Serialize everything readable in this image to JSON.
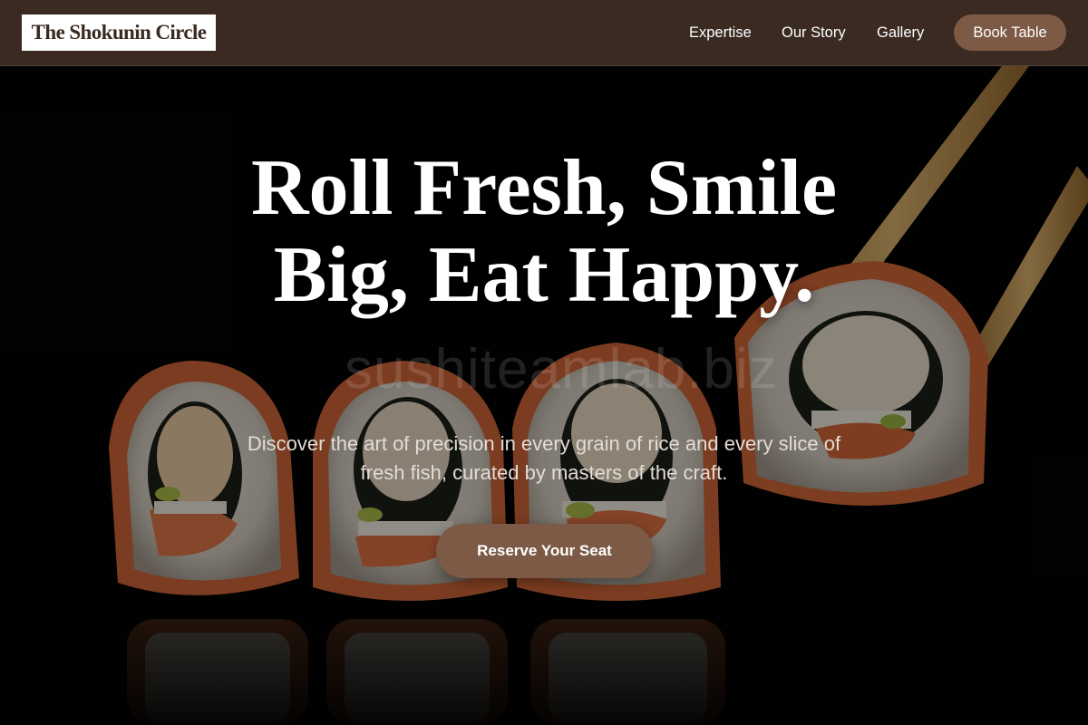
{
  "header": {
    "logo_text": "The Shokunin Circle",
    "nav_links": [
      "Expertise",
      "Our Story",
      "Gallery"
    ],
    "cta_label": "Book Table"
  },
  "hero": {
    "headline": "Roll Fresh, Smile Big, Eat Happy.",
    "subtext": "Discover the art of precision in every grain of rice and every slice of fresh fish, curated by masters of the craft.",
    "cta_label": "Reserve Your Seat",
    "watermark_text": "sushiteamlab.biz",
    "background_image": "sushi-rolls-with-chopsticks-photo"
  },
  "colors": {
    "nav_background": "#3a2a22",
    "accent_button": "#7d5a46",
    "logo_background": "#ffffff",
    "hero_background": "#000000"
  }
}
